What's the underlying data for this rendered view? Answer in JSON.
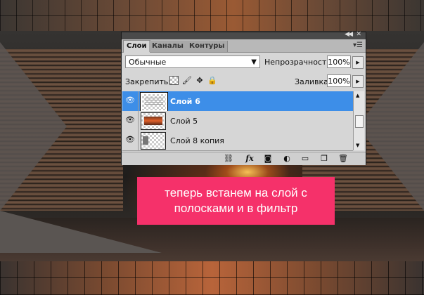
{
  "panel": {
    "tabs": [
      {
        "label": "Слои",
        "active": true
      },
      {
        "label": "Каналы",
        "active": false
      },
      {
        "label": "Контуры",
        "active": false
      }
    ],
    "blend_mode": "Обычные",
    "opacity_label": "Непрозрачность:",
    "opacity_value": "100%",
    "lock_label": "Закрепить:",
    "fill_label": "Заливка:",
    "fill_value": "100%",
    "layers": [
      {
        "name": "Слой 6",
        "selected": true,
        "visible": true
      },
      {
        "name": "Слой 5",
        "selected": false,
        "visible": true
      },
      {
        "name": "Слой 8 копия",
        "selected": false,
        "visible": true
      }
    ],
    "bottom_icons": [
      "link-icon",
      "fx-icon",
      "mask-icon",
      "adjustment-icon",
      "group-folder-icon",
      "new-layer-icon",
      "trash-icon"
    ],
    "fx_label": "fx",
    "accent_color": "#3d8ee8"
  },
  "caption": {
    "line1": "теперь встанем на слой с",
    "line2": "полосками и в фильтр",
    "background_color": "#f5316a"
  }
}
